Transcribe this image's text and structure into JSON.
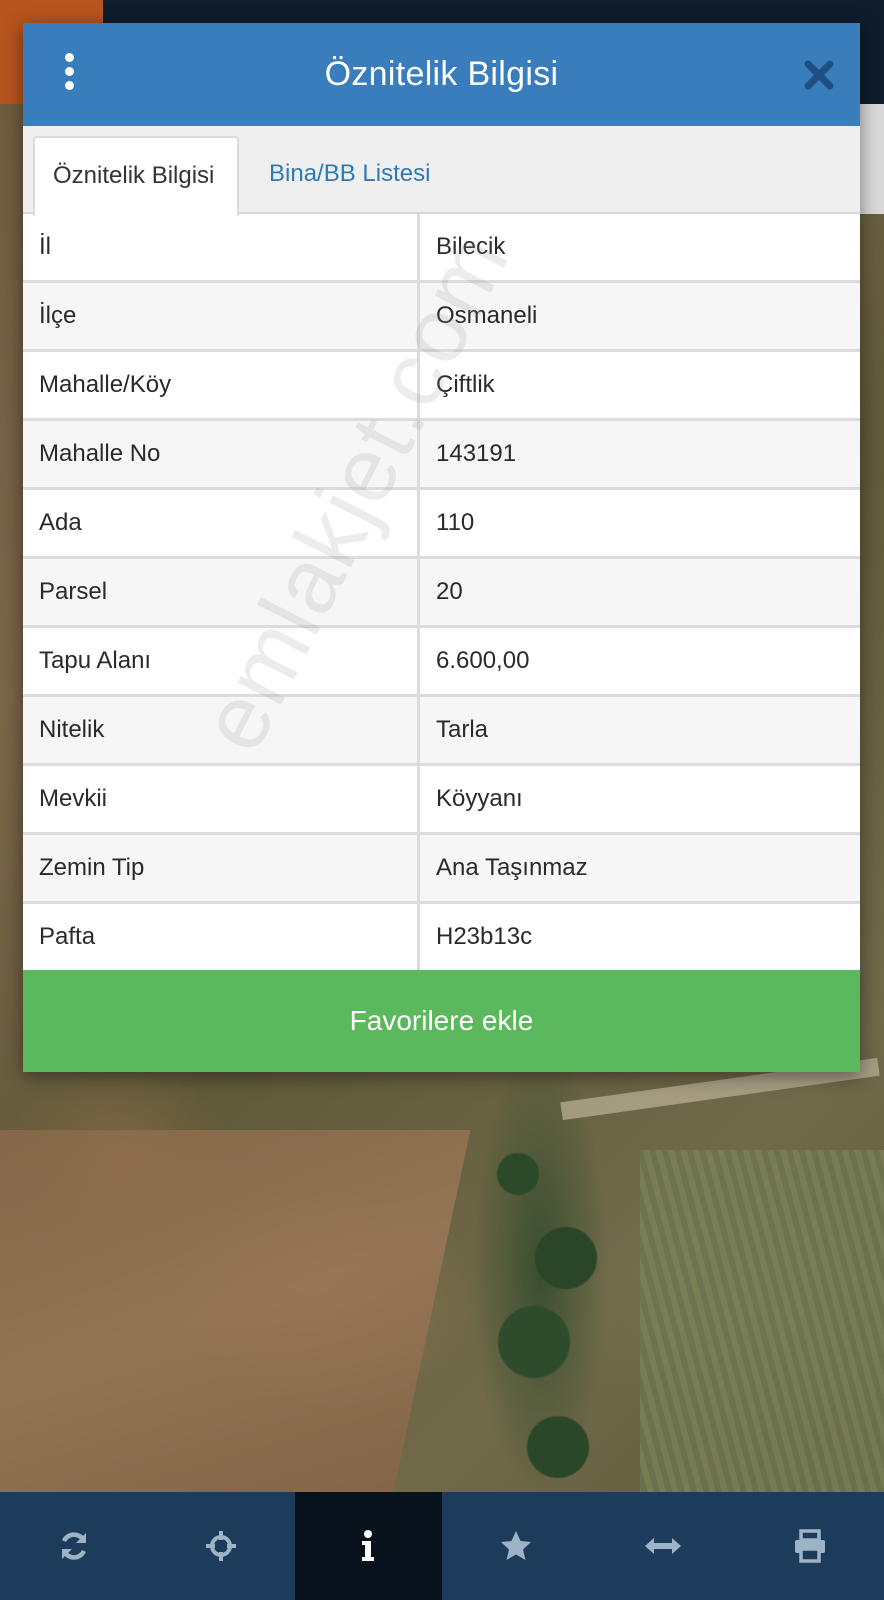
{
  "dialog": {
    "title": "Öznitelik Bilgisi",
    "tabs": [
      {
        "label": "Öznitelik Bilgisi",
        "active": true
      },
      {
        "label": "Bina/BB Listesi",
        "active": false
      }
    ],
    "rows": [
      {
        "key": "İl",
        "value": "Bilecik"
      },
      {
        "key": "İlçe",
        "value": "Osmaneli"
      },
      {
        "key": "Mahalle/Köy",
        "value": "Çiftlik"
      },
      {
        "key": "Mahalle No",
        "value": "143191"
      },
      {
        "key": "Ada",
        "value": "110"
      },
      {
        "key": "Parsel",
        "value": "20"
      },
      {
        "key": "Tapu Alanı",
        "value": "6.600,00"
      },
      {
        "key": "Nitelik",
        "value": "Tarla"
      },
      {
        "key": "Mevkii",
        "value": "Köyyanı"
      },
      {
        "key": "Zemin Tip",
        "value": "Ana Taşınmaz"
      },
      {
        "key": "Pafta",
        "value": "H23b13c"
      }
    ],
    "favorite_button": "Favorilere ekle"
  },
  "watermark": "emlakjet.com",
  "toolbar": {
    "items": [
      {
        "icon": "refresh-icon",
        "active": false
      },
      {
        "icon": "crosshair-icon",
        "active": false
      },
      {
        "icon": "info-icon",
        "active": true
      },
      {
        "icon": "star-icon",
        "active": false
      },
      {
        "icon": "measure-icon",
        "active": false
      },
      {
        "icon": "print-icon",
        "active": false
      }
    ]
  },
  "colors": {
    "header": "#3a7dbd",
    "tab_link": "#2e7bb4",
    "favorite_button": "#5cb85c",
    "toolbar": "#1d3c5c",
    "toolbar_active": "#08121d",
    "toolbar_icon": "#9fb3c6"
  }
}
